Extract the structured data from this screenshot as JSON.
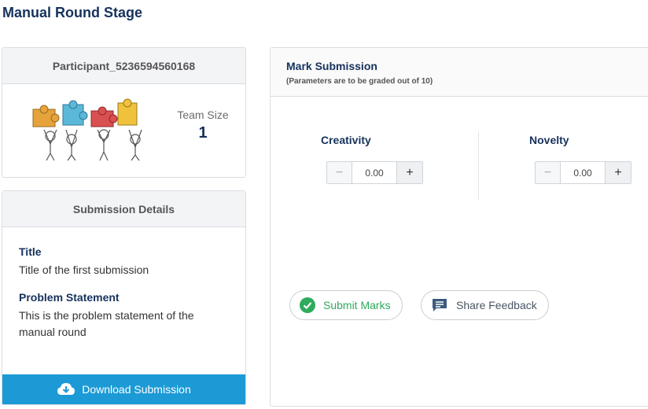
{
  "page": {
    "title": "Manual Round Stage"
  },
  "participant": {
    "name": "Participant_5236594560168",
    "team_size_label": "Team Size",
    "team_size": "1"
  },
  "details": {
    "header": "Submission Details",
    "title_label": "Title",
    "title_value": "Title of the first submission",
    "problem_label": "Problem Statement",
    "problem_value": "This is the problem statement of the manual round",
    "download_label": "Download Submission"
  },
  "marks": {
    "header": "Mark Submission",
    "subheader": "(Parameters are to be graded out of 10)",
    "params": [
      {
        "name": "Creativity",
        "value": "0.00"
      },
      {
        "name": "Novelty",
        "value": "0.00"
      }
    ],
    "submit_label": "Submit Marks",
    "feedback_label": "Share Feedback"
  },
  "colors": {
    "brand": "#16325c",
    "download": "#1c9ad6",
    "submit": "#2eab5d"
  },
  "icons": {
    "minus": "minus-icon",
    "plus": "plus-icon",
    "download": "cloud-download-icon",
    "submit": "check-circle-icon",
    "feedback": "message-icon"
  }
}
